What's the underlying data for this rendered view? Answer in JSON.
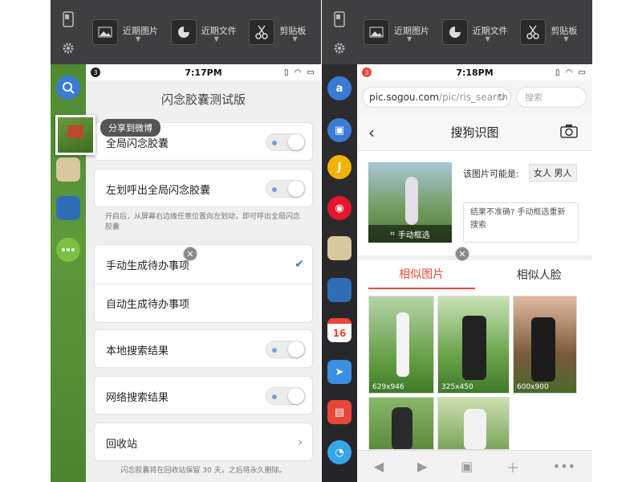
{
  "toolbar": {
    "recent_images": "近期图片",
    "recent_files": "近期文件",
    "clipboard": "剪贴板"
  },
  "left": {
    "status": {
      "badge": "3",
      "time": "7:17PM"
    },
    "title": "闪念胶囊测试版",
    "tooltip": "分享到微博",
    "rows": {
      "global": "全局闪念胶囊",
      "swipe": "左划呼出全局闪念胶囊",
      "swipe_note": "开启后，从屏幕右边缘任意位置向左划动，即可呼出全局闪念胶囊",
      "manual_todo": "手动生成待办事项",
      "auto_todo": "自动生成待办事项",
      "local_search": "本地搜索结果",
      "web_search": "网络搜索结果",
      "recycle": "回收站",
      "recycle_note": "闪念胶囊将在回收站保留 30 天，之后将永久删除。"
    }
  },
  "right": {
    "status": {
      "badge": "3",
      "time": "7:18PM"
    },
    "url": {
      "host": "pic.sogou.com",
      "path": "/pic/ris_search"
    },
    "search_placeholder": "搜索",
    "page_title": "搜狗识图",
    "maybe_label": "该图片可能是:",
    "maybe_tags": [
      "女人",
      "男人"
    ],
    "feedback": "结果不准确? 手动框选重新搜索",
    "manual_select": "手动框选",
    "tabs": [
      "相似图片",
      "相似人脸"
    ],
    "photos": [
      "629x946",
      "325x450",
      "600x900"
    ],
    "calendar_day": "16"
  },
  "colors": {
    "accent": "#e84a3c",
    "toggle_dot": "#7b9be0",
    "check": "#3a7bd5"
  }
}
